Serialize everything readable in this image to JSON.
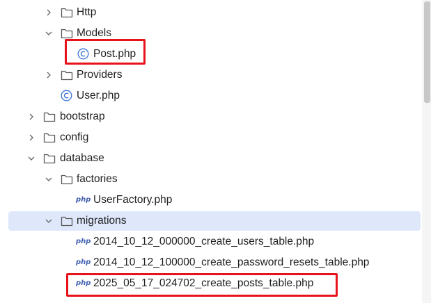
{
  "tree": {
    "items": [
      {
        "label": "Http",
        "kind": "folder",
        "expanded": false,
        "depth": 2,
        "icon": "folder-icon"
      },
      {
        "label": "Models",
        "kind": "folder",
        "expanded": true,
        "depth": 2,
        "icon": "folder-icon"
      },
      {
        "label": "Post.php",
        "kind": "class",
        "depth": 3,
        "icon": "class-c-icon",
        "highlighted": true
      },
      {
        "label": "Providers",
        "kind": "folder",
        "expanded": false,
        "depth": 2,
        "icon": "folder-icon"
      },
      {
        "label": "User.php",
        "kind": "class",
        "depth": 2,
        "icon": "class-c-icon"
      },
      {
        "label": "bootstrap",
        "kind": "folder",
        "expanded": false,
        "depth": 1,
        "icon": "folder-icon"
      },
      {
        "label": "config",
        "kind": "folder",
        "expanded": false,
        "depth": 1,
        "icon": "folder-icon"
      },
      {
        "label": "database",
        "kind": "folder",
        "expanded": true,
        "depth": 1,
        "icon": "folder-icon"
      },
      {
        "label": "factories",
        "kind": "folder",
        "expanded": true,
        "depth": 2,
        "icon": "folder-icon"
      },
      {
        "label": "UserFactory.php",
        "kind": "php",
        "depth": 3,
        "icon": "php-file-icon"
      },
      {
        "label": "migrations",
        "kind": "folder",
        "expanded": true,
        "depth": 2,
        "icon": "folder-icon",
        "selected": true
      },
      {
        "label": "2014_10_12_000000_create_users_table.php",
        "kind": "php",
        "depth": 3,
        "icon": "php-file-icon"
      },
      {
        "label": "2014_10_12_100000_create_password_resets_table.php",
        "kind": "php",
        "depth": 3,
        "icon": "php-file-icon"
      },
      {
        "label": "2025_05_17_024702_create_posts_table.php",
        "kind": "php",
        "depth": 3,
        "icon": "php-file-icon",
        "highlighted": true
      }
    ]
  },
  "icons": {
    "php_badge": "php",
    "class_badge": "C"
  },
  "colors": {
    "selection": "#dfe8fb",
    "highlight_border": "#e8121b",
    "class_icon": "#3a73d8",
    "php_icon": "#4563b3",
    "folder_stroke": "#5a5a5a",
    "chevron": "#6b6b6b"
  }
}
